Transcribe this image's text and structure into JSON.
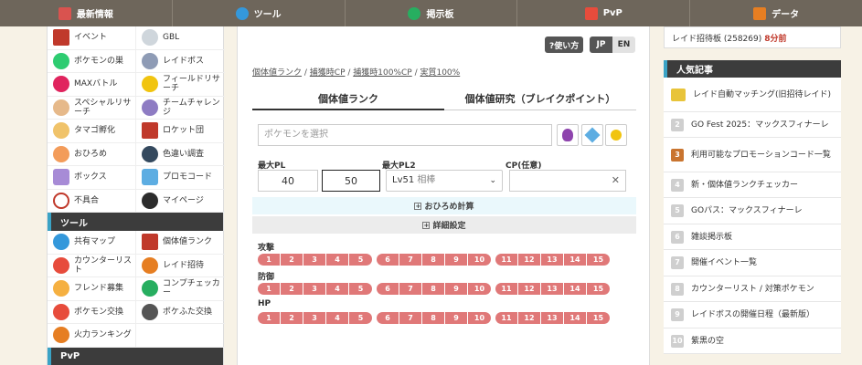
{
  "topnav": [
    {
      "label": "最新情報",
      "icon": "calendar-icon",
      "color": "#d9534f"
    },
    {
      "label": "ツール",
      "icon": "share-icon",
      "color": "#3498db"
    },
    {
      "label": "掲示板",
      "icon": "chat-icon",
      "color": "#27ae60"
    },
    {
      "label": "PvP",
      "icon": "pvp-badge-icon",
      "color": "#e74c3c"
    },
    {
      "label": "データ",
      "icon": "database-icon",
      "color": "#e67e22"
    }
  ],
  "sidebar": {
    "group1": [
      {
        "label": "イベント",
        "icon": "calendar-icon"
      },
      {
        "label": "GBL",
        "icon": "gbl-icon"
      },
      {
        "label": "ポケモンの巣",
        "icon": "nest-pin-icon"
      },
      {
        "label": "レイドボス",
        "icon": "raid-egg-icon"
      },
      {
        "label": "MAXバトル",
        "icon": "max-battle-icon"
      },
      {
        "label": "フィールドリサーチ",
        "icon": "binoculars-icon"
      },
      {
        "label": "スペシャルリサーチ",
        "icon": "professor-icon"
      },
      {
        "label": "チームチャレンジ",
        "icon": "team-icon"
      },
      {
        "label": "タマゴ孵化",
        "icon": "egg-icon"
      },
      {
        "label": "ロケット団",
        "icon": "rocket-r-icon"
      },
      {
        "label": "おひろめ",
        "icon": "showcase-icon"
      },
      {
        "label": "色違い調査",
        "icon": "sparkle-icon"
      },
      {
        "label": "ボックス",
        "icon": "box-icon"
      },
      {
        "label": "プロモコード",
        "icon": "promo-code-icon"
      },
      {
        "label": "不具合",
        "icon": "warning-icon"
      },
      {
        "label": "マイページ",
        "icon": "user-icon"
      }
    ],
    "tools_heading": "ツール",
    "tools": [
      {
        "label": "共有マップ",
        "icon": "share-map-icon"
      },
      {
        "label": "個体値ランク",
        "icon": "iv-rank-icon"
      },
      {
        "label": "カウンターリスト",
        "icon": "counter-list-icon"
      },
      {
        "label": "レイド招待",
        "icon": "raid-invite-icon"
      },
      {
        "label": "フレンド募集",
        "icon": "friend-icon"
      },
      {
        "label": "コンプチェッカー",
        "icon": "checker-icon"
      },
      {
        "label": "ポケモン交換",
        "icon": "trade-icon"
      },
      {
        "label": "ポケふた交換",
        "icon": "pokelid-icon"
      },
      {
        "label": "火力ランキング",
        "icon": "fire-icon"
      }
    ],
    "pvp_heading": "PvP"
  },
  "main": {
    "howto": "?使い方",
    "lang_jp": "JP",
    "lang_en": "EN",
    "breadcrumbs": [
      "個体値ランク",
      "捕獲時CP",
      "捕獲時100%CP",
      "実質100%"
    ],
    "tabs": [
      "個体値ランク",
      "個体値研究（ブレイクポイント）"
    ],
    "pokemon_placeholder": "ポケモンを選択",
    "max_pl_label": "最大PL",
    "max_pl2_label": "最大PL2",
    "cp_label": "CP(任意)",
    "min_pl_value": "40",
    "max_pl_value": "50",
    "pl2_select": "Lv51",
    "pl2_select_note": "相棒",
    "ohirome_bar": "おひろめ計算",
    "detail_bar": "詳細設定",
    "attack_label": "攻撃",
    "defense_label": "防御",
    "hp_label": "HP",
    "iv_values": [
      "1",
      "2",
      "3",
      "4",
      "5",
      "6",
      "7",
      "8",
      "9",
      "10",
      "11",
      "12",
      "13",
      "14",
      "15"
    ]
  },
  "right": {
    "raid_text": "レイド招待板 (258269)",
    "raid_time": "8分前",
    "popular_heading": "人気記事",
    "articles": [
      {
        "num": "",
        "title": "レイド自動マッチング(旧招待レイド)"
      },
      {
        "num": "2",
        "title": "GO Fest 2025：マックスフィナーレ"
      },
      {
        "num": "3",
        "title": "利用可能なプロモーションコード一覧"
      },
      {
        "num": "4",
        "title": "新・個体値ランクチェッカー"
      },
      {
        "num": "5",
        "title": "GOパス：マックスフィナーレ"
      },
      {
        "num": "6",
        "title": "雑談掲示板"
      },
      {
        "num": "7",
        "title": "開催イベント一覧"
      },
      {
        "num": "8",
        "title": "カウンターリスト / 対策ポケモン"
      },
      {
        "num": "9",
        "title": "レイドボスの開催日程（最新版）"
      },
      {
        "num": "10",
        "title": "紫黒の空"
      }
    ]
  }
}
